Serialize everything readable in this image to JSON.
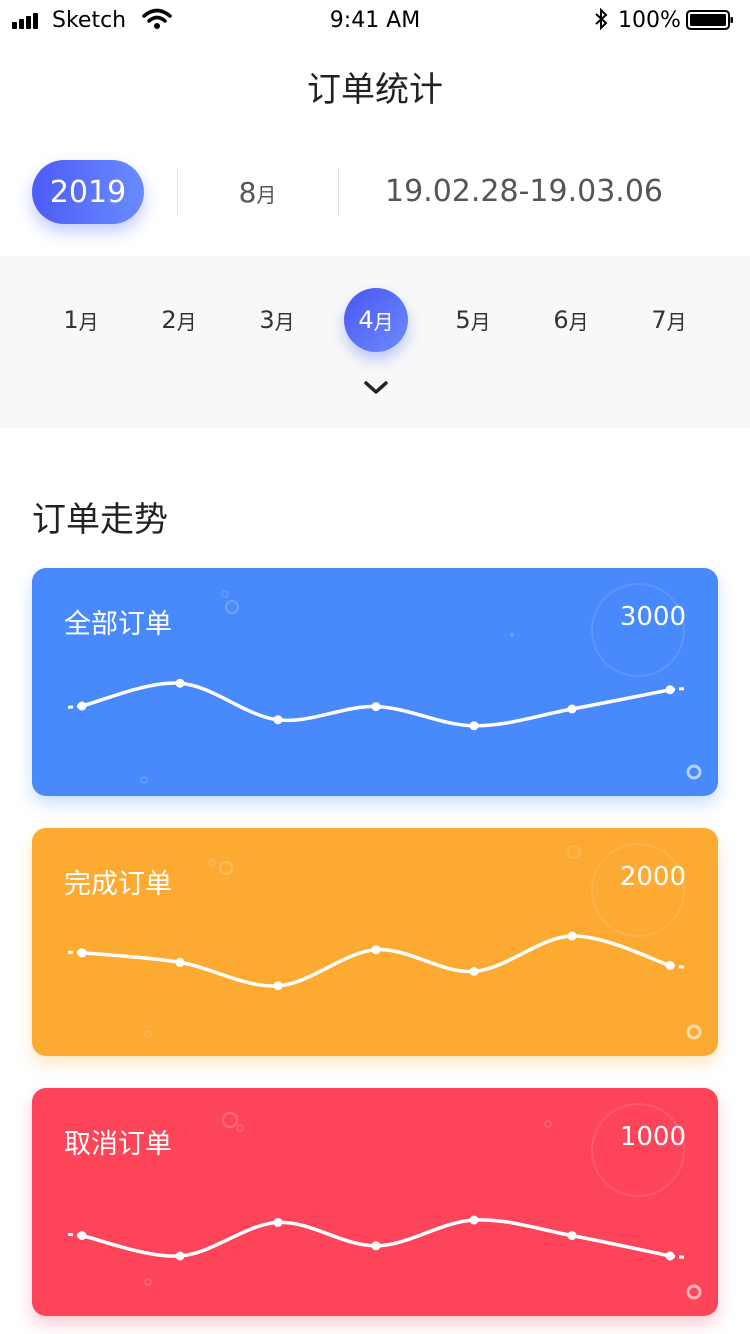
{
  "status_bar": {
    "carrier": "Sketch",
    "time": "9:41 AM",
    "battery": "100%"
  },
  "page": {
    "title": "订单统计"
  },
  "selector": {
    "year": "2019",
    "month_num": "8",
    "month_unit": "月",
    "date_range": "19.02.28-19.03.06"
  },
  "month_strip": {
    "months": [
      {
        "num": "1",
        "unit": "月"
      },
      {
        "num": "2",
        "unit": "月"
      },
      {
        "num": "3",
        "unit": "月"
      },
      {
        "num": "4",
        "unit": "月"
      },
      {
        "num": "5",
        "unit": "月"
      },
      {
        "num": "6",
        "unit": "月"
      },
      {
        "num": "7",
        "unit": "月"
      }
    ],
    "active_index": 3
  },
  "section": {
    "title": "订单走势"
  },
  "cards": [
    {
      "label": "全部订单",
      "value": "3000",
      "color": "#4889fb",
      "points": [
        0.5,
        0.88,
        0.27,
        0.49,
        0.17,
        0.45,
        0.77
      ]
    },
    {
      "label": "完成订单",
      "value": "2000",
      "color": "#fdaa33",
      "points": [
        0.72,
        0.56,
        0.17,
        0.77,
        0.41,
        1.0,
        0.51
      ]
    },
    {
      "label": "取消订单",
      "value": "1000",
      "color": "#fd4458",
      "points": [
        0.34,
        0.0,
        0.56,
        0.17,
        0.6,
        0.34,
        0.0
      ]
    }
  ],
  "icons": {
    "signal": "signal-icon",
    "wifi": "wifi-icon",
    "bluetooth": "bluetooth-icon",
    "battery": "battery-icon",
    "expand": "chevron-down-icon"
  }
}
